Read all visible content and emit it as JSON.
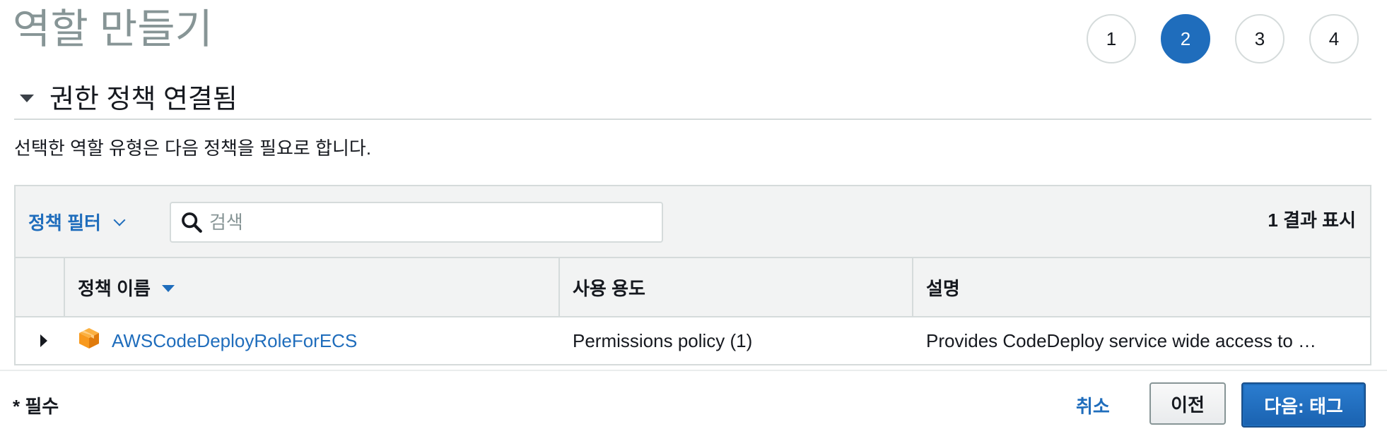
{
  "page": {
    "title": "역할 만들기"
  },
  "steps": [
    {
      "label": "1",
      "active": false
    },
    {
      "label": "2",
      "active": true
    },
    {
      "label": "3",
      "active": false
    },
    {
      "label": "4",
      "active": false
    }
  ],
  "section": {
    "title": "권한 정책 연결됨",
    "description": "선택한 역할 유형은 다음 정책을 필요로 합니다."
  },
  "toolbar": {
    "filter_label": "정책 필터",
    "search_placeholder": "검색",
    "result_count": "1 결과 표시"
  },
  "table": {
    "columns": {
      "name": "정책 이름",
      "usage": "사용 용도",
      "description": "설명"
    },
    "rows": [
      {
        "name": "AWSCodeDeployRoleForECS",
        "usage": "Permissions policy (1)",
        "description": "Provides CodeDeploy service wide access to …"
      }
    ]
  },
  "footer": {
    "required_label": "* 필수",
    "cancel_label": "취소",
    "prev_label": "이전",
    "next_label": "다음: 태그"
  },
  "colors": {
    "accent": "#1f6dbc",
    "package_icon": "#f8991d",
    "title_gray": "#879596"
  },
  "icons": {
    "search": "search-icon",
    "package": "package-icon",
    "expand": "caret-right-icon",
    "sort": "sort-desc-icon",
    "filter": "chevron-down-icon"
  }
}
